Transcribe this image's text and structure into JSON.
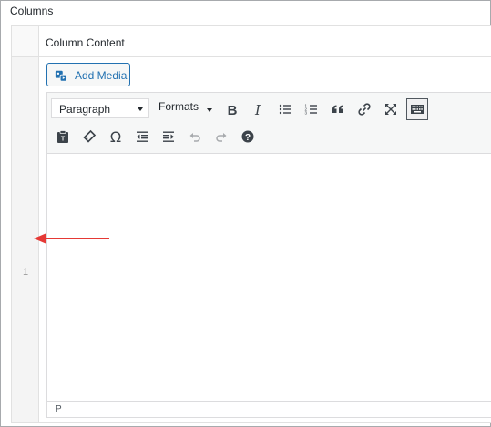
{
  "section": {
    "title": "Columns"
  },
  "table": {
    "header": {
      "column_label": "Column Content"
    },
    "rows": [
      {
        "index": "1"
      }
    ]
  },
  "editor": {
    "add_media_label": "Add Media",
    "block_format": {
      "selected": "Paragraph"
    },
    "formats_label": "Formats",
    "toolbar_row1": [
      "bold-icon",
      "italic-icon",
      "bullet-list-icon",
      "numbered-list-icon",
      "blockquote-icon",
      "link-icon",
      "fullscreen-icon",
      "toolbar-toggle-icon"
    ],
    "toolbar_row2": [
      "paste-text-icon",
      "clear-formatting-icon",
      "special-character-icon",
      "outdent-icon",
      "indent-icon",
      "undo-icon",
      "redo-icon",
      "help-icon"
    ],
    "toolbar_toggle_active": true,
    "statusbar_path": "P"
  },
  "colors": {
    "accent_blue": "#2271b1",
    "annotation_arrow": "#e53935",
    "icon": "#3c434a",
    "icon_disabled": "#a7aaad"
  }
}
